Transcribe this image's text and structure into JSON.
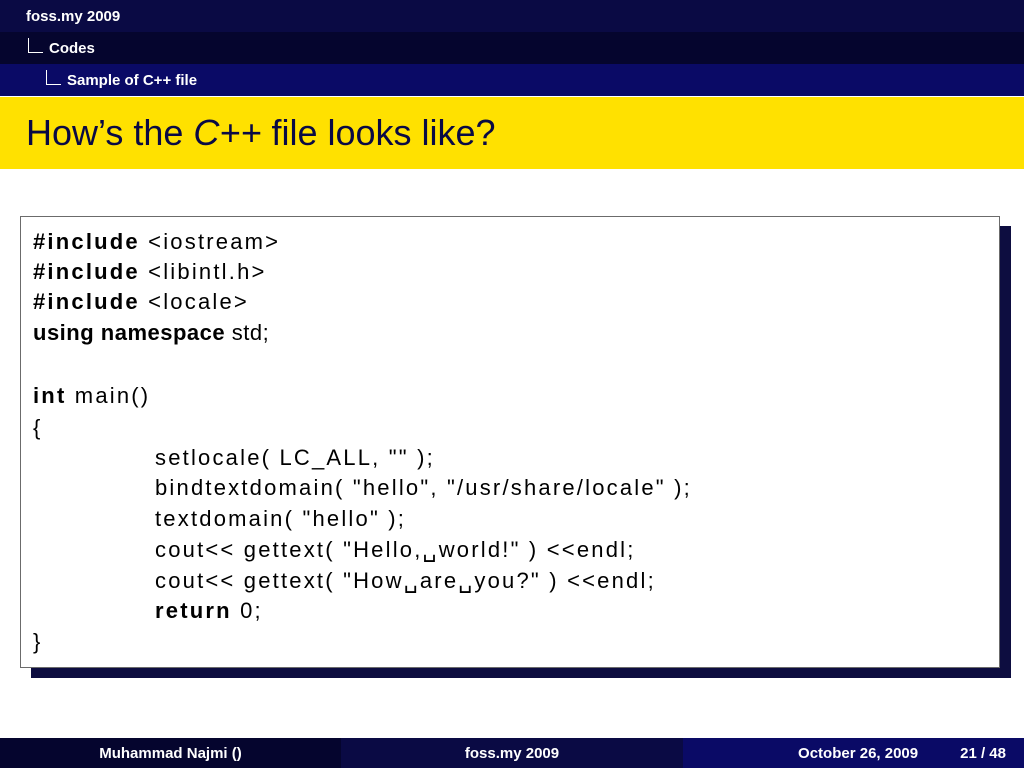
{
  "nav": {
    "level1": "foss.my 2009",
    "level2": "Codes",
    "level3": "Sample of C++ file"
  },
  "title": {
    "prefix": "How’s the ",
    "emphasis": "C++",
    "suffix": " file looks like?"
  },
  "code": {
    "line1": {
      "kw": "#include",
      "rest": " <iostream>"
    },
    "line2": {
      "kw": "#include",
      "rest": " <libintl.h>"
    },
    "line3": {
      "kw": "#include",
      "rest": " <locale>"
    },
    "line4": {
      "kw": "using namespace",
      "rest": " std;"
    },
    "line6": {
      "kw": "int",
      "rest": " main()"
    },
    "line7": "{",
    "line8": "setlocale( LC_ALL, \"\" );",
    "line9": "bindtextdomain( \"hello\", \"/usr/share/locale\" );",
    "line10": "textdomain( \"hello\" );",
    "line11": "cout<< gettext( \"Hello,␣world!\" ) <<endl;",
    "line12": "cout<< gettext( \"How␣are␣you?\" ) <<endl;",
    "line13": {
      "kw": "return",
      "rest": " 0;"
    },
    "line14": "}"
  },
  "footer": {
    "author": "Muhammad Najmi ()",
    "event": "foss.my 2009",
    "date": "October 26, 2009",
    "page": "21 / 48"
  }
}
